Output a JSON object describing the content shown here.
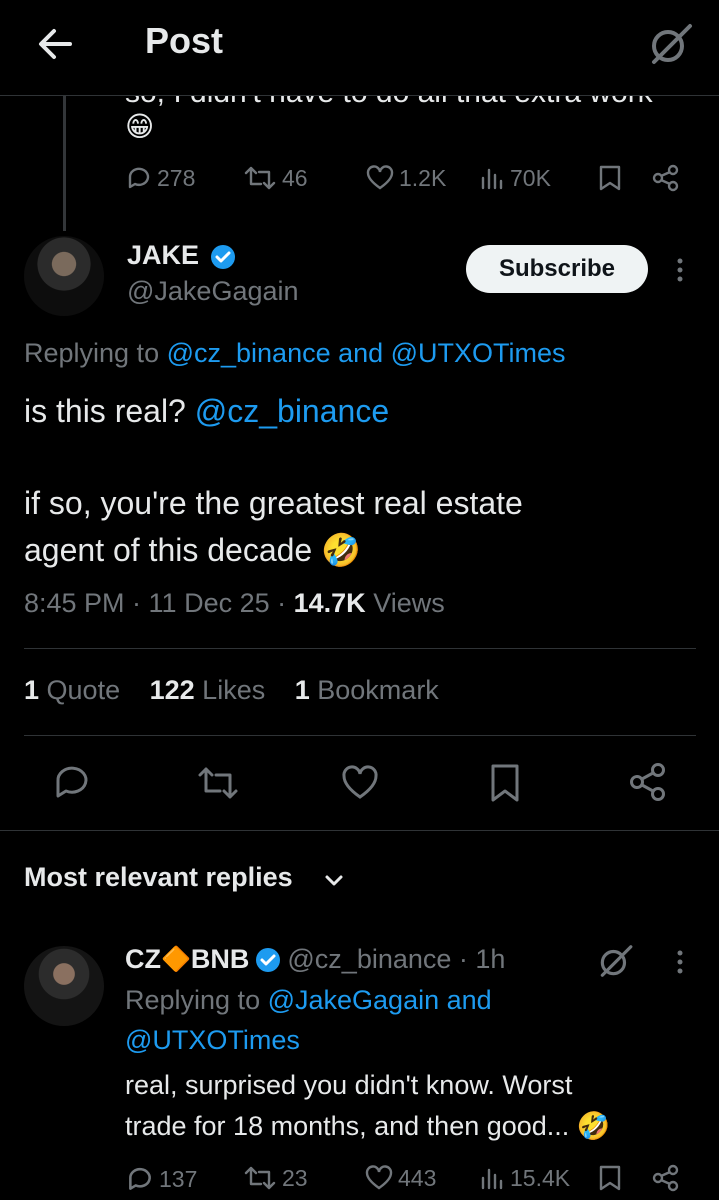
{
  "header": {
    "title": "Post"
  },
  "prev_tweet": {
    "partial_text": "so, I didn't have to do all that extra work",
    "emoji": "😁",
    "replies": "278",
    "reposts": "46",
    "likes": "1.2K",
    "views": "70K"
  },
  "main_tweet": {
    "author_name": "JAKE",
    "author_handle": "@JakeGagain",
    "subscribe_label": "Subscribe",
    "replying_prefix": "Replying to ",
    "replying_to": "@cz_binance and @UTXOTimes",
    "line1_text": "is this real? ",
    "line1_mention": "@cz_binance",
    "line2": "if so, you're the greatest real estate",
    "line3": "agent of this decade",
    "line3_emoji": "🤣",
    "time": "8:45 PM · 11 Dec 25 · ",
    "views_count": "14.7K",
    "views_label": " Views",
    "quotes_count": "1",
    "quotes_label": " Quote",
    "likes_count": "122",
    "likes_label": " Likes",
    "bookmarks_count": "1",
    "bookmarks_label": " Bookmark"
  },
  "replies_section": {
    "sort_label": "Most relevant replies"
  },
  "reply": {
    "name_part1": "CZ ",
    "name_emoji": "🔶",
    "name_part2": " BNB",
    "handle_time": "@cz_binance · 1h",
    "replying_prefix": "Replying to ",
    "replying_to_1": "@JakeGagain and",
    "replying_to_2": "@UTXOTimes",
    "text1": "real, surprised you didn't know. Worst",
    "text2": "trade for 18 months, and then good... ",
    "text2_emoji": "🤣",
    "replies": "137",
    "reposts": "23",
    "likes": "443",
    "views": "15.4K"
  },
  "colors": {
    "accent": "#1d9bf0",
    "muted": "#71767b",
    "bg": "#000000",
    "text": "#e7e9ea"
  },
  "icons": [
    "back-arrow-icon",
    "grok-icon",
    "reply-icon",
    "repost-icon",
    "like-icon",
    "views-icon",
    "bookmark-icon",
    "share-icon",
    "verified-icon",
    "more-icon",
    "chevron-down-icon"
  ]
}
